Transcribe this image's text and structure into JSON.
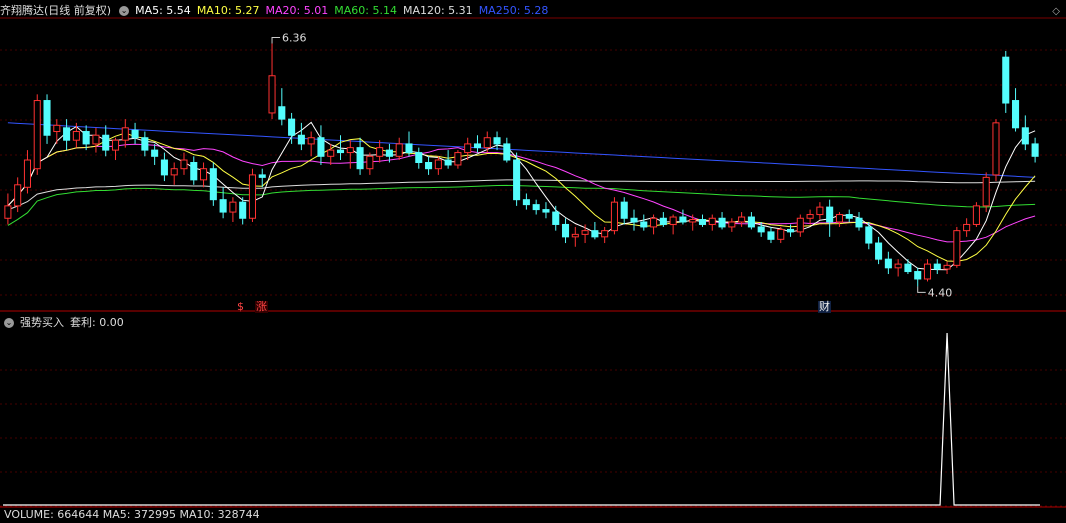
{
  "header": {
    "stock_name": "齐翔腾达(日线 前复权)",
    "ma": [
      {
        "label": "MA5: 5.54",
        "color": "#ffffff"
      },
      {
        "label": "MA10: 5.27",
        "color": "#ffff44"
      },
      {
        "label": "MA20: 5.01",
        "color": "#ff44ff"
      },
      {
        "label": "MA60: 5.14",
        "color": "#33dd33"
      },
      {
        "label": "MA120: 5.31",
        "color": "#dddddd"
      },
      {
        "label": "MA250: 5.28",
        "color": "#3355ff"
      }
    ]
  },
  "sub_header": {
    "indicator": "强势买入",
    "arbitrage": "套利: 0.00"
  },
  "volume_header": "VOLUME: 664644  MA5: 372995  MA10: 328744",
  "markers": {
    "zhang": "涨",
    "s": "$",
    "cai": "财"
  },
  "colors": {
    "up": "#ff3232",
    "down": "#54fcfc",
    "grid": "#8b0000",
    "ma5": "#ffffff",
    "ma10": "#ffff44",
    "ma20": "#ff44ff",
    "ma60": "#33dd33",
    "ma120": "#dddddd",
    "ma250": "#3355ff"
  },
  "icons": {
    "collapse": "chevron-down-icon",
    "corner": "diamond-icon"
  },
  "chart_data": {
    "type": "candlestick",
    "price_ylim": [
      4.25,
      6.55
    ],
    "annotations": [
      {
        "label": "6.36",
        "value": 6.36
      },
      {
        "label": "4.40",
        "value": 4.4
      }
    ],
    "candles": [
      [
        4.95,
        5.15,
        4.9,
        5.05
      ],
      [
        5.05,
        5.28,
        5.0,
        5.22
      ],
      [
        5.2,
        5.5,
        5.15,
        5.42
      ],
      [
        5.35,
        5.95,
        5.3,
        5.9
      ],
      [
        5.9,
        5.95,
        5.55,
        5.62
      ],
      [
        5.65,
        5.75,
        5.55,
        5.7
      ],
      [
        5.68,
        5.75,
        5.5,
        5.58
      ],
      [
        5.58,
        5.72,
        5.52,
        5.65
      ],
      [
        5.65,
        5.7,
        5.5,
        5.55
      ],
      [
        5.55,
        5.68,
        5.48,
        5.62
      ],
      [
        5.62,
        5.7,
        5.45,
        5.5
      ],
      [
        5.5,
        5.6,
        5.42,
        5.58
      ],
      [
        5.58,
        5.75,
        5.52,
        5.68
      ],
      [
        5.66,
        5.72,
        5.55,
        5.6
      ],
      [
        5.6,
        5.65,
        5.45,
        5.5
      ],
      [
        5.5,
        5.55,
        5.38,
        5.45
      ],
      [
        5.42,
        5.48,
        5.25,
        5.3
      ],
      [
        5.3,
        5.4,
        5.22,
        5.35
      ],
      [
        5.35,
        5.48,
        5.3,
        5.42
      ],
      [
        5.4,
        5.45,
        5.22,
        5.26
      ],
      [
        5.26,
        5.4,
        5.2,
        5.35
      ],
      [
        5.35,
        5.4,
        5.05,
        5.1
      ],
      [
        5.1,
        5.2,
        4.95,
        5.0
      ],
      [
        5.0,
        5.12,
        4.92,
        5.08
      ],
      [
        5.08,
        5.12,
        4.9,
        4.95
      ],
      [
        4.95,
        5.35,
        4.92,
        5.3
      ],
      [
        5.3,
        5.35,
        5.2,
        5.28
      ],
      [
        5.8,
        6.36,
        5.75,
        6.1
      ],
      [
        5.85,
        6.0,
        5.7,
        5.75
      ],
      [
        5.75,
        5.8,
        5.55,
        5.62
      ],
      [
        5.62,
        5.72,
        5.5,
        5.55
      ],
      [
        5.55,
        5.65,
        5.45,
        5.6
      ],
      [
        5.6,
        5.7,
        5.38,
        5.45
      ],
      [
        5.45,
        5.55,
        5.38,
        5.5
      ],
      [
        5.5,
        5.62,
        5.42,
        5.48
      ],
      [
        5.48,
        5.58,
        5.35,
        5.52
      ],
      [
        5.52,
        5.6,
        5.3,
        5.35
      ],
      [
        5.35,
        5.48,
        5.3,
        5.45
      ],
      [
        5.45,
        5.58,
        5.4,
        5.52
      ],
      [
        5.5,
        5.55,
        5.4,
        5.45
      ],
      [
        5.45,
        5.6,
        5.42,
        5.55
      ],
      [
        5.55,
        5.65,
        5.45,
        5.48
      ],
      [
        5.48,
        5.52,
        5.35,
        5.4
      ],
      [
        5.4,
        5.45,
        5.3,
        5.35
      ],
      [
        5.35,
        5.45,
        5.3,
        5.42
      ],
      [
        5.42,
        5.5,
        5.35,
        5.38
      ],
      [
        5.38,
        5.5,
        5.35,
        5.48
      ],
      [
        5.48,
        5.6,
        5.42,
        5.55
      ],
      [
        5.55,
        5.62,
        5.48,
        5.52
      ],
      [
        5.52,
        5.65,
        5.48,
        5.6
      ],
      [
        5.6,
        5.65,
        5.5,
        5.55
      ],
      [
        5.55,
        5.6,
        5.4,
        5.42
      ],
      [
        5.42,
        5.48,
        5.05,
        5.1
      ],
      [
        5.1,
        5.15,
        5.02,
        5.06
      ],
      [
        5.06,
        5.1,
        4.98,
        5.02
      ],
      [
        5.02,
        5.08,
        4.95,
        5.0
      ],
      [
        5.0,
        5.05,
        4.85,
        4.9
      ],
      [
        4.9,
        4.95,
        4.75,
        4.8
      ],
      [
        4.8,
        4.88,
        4.72,
        4.82
      ],
      [
        4.82,
        4.9,
        4.75,
        4.85
      ],
      [
        4.85,
        4.92,
        4.78,
        4.8
      ],
      [
        4.8,
        4.88,
        4.75,
        4.85
      ],
      [
        4.85,
        5.12,
        4.82,
        5.08
      ],
      [
        5.08,
        5.12,
        4.9,
        4.95
      ],
      [
        4.95,
        5.02,
        4.85,
        4.92
      ],
      [
        4.92,
        4.98,
        4.85,
        4.88
      ],
      [
        4.88,
        4.98,
        4.82,
        4.95
      ],
      [
        4.95,
        5.0,
        4.88,
        4.9
      ],
      [
        4.9,
        4.98,
        4.82,
        4.96
      ],
      [
        4.96,
        5.02,
        4.9,
        4.92
      ],
      [
        4.92,
        4.98,
        4.85,
        4.94
      ],
      [
        4.94,
        4.98,
        4.88,
        4.9
      ],
      [
        4.9,
        4.98,
        4.85,
        4.95
      ],
      [
        4.95,
        5.0,
        4.86,
        4.88
      ],
      [
        4.88,
        4.95,
        4.84,
        4.92
      ],
      [
        4.92,
        5.0,
        4.88,
        4.96
      ],
      [
        4.96,
        5.0,
        4.86,
        4.88
      ],
      [
        4.88,
        4.92,
        4.8,
        4.84
      ],
      [
        4.84,
        4.88,
        4.75,
        4.78
      ],
      [
        4.78,
        4.88,
        4.75,
        4.86
      ],
      [
        4.86,
        4.9,
        4.8,
        4.84
      ],
      [
        4.84,
        4.98,
        4.8,
        4.95
      ],
      [
        4.95,
        5.02,
        4.9,
        4.98
      ],
      [
        4.98,
        5.08,
        4.94,
        5.04
      ],
      [
        5.04,
        5.1,
        4.8,
        4.92
      ],
      [
        4.92,
        5.0,
        4.88,
        4.98
      ],
      [
        4.98,
        5.02,
        4.92,
        4.95
      ],
      [
        4.95,
        5.0,
        4.85,
        4.88
      ],
      [
        4.88,
        4.92,
        4.7,
        4.75
      ],
      [
        4.75,
        4.8,
        4.58,
        4.62
      ],
      [
        4.62,
        4.68,
        4.5,
        4.55
      ],
      [
        4.55,
        4.62,
        4.48,
        4.58
      ],
      [
        4.58,
        4.62,
        4.5,
        4.52
      ],
      [
        4.52,
        4.55,
        4.4,
        4.46
      ],
      [
        4.46,
        4.62,
        4.44,
        4.58
      ],
      [
        4.58,
        4.62,
        4.5,
        4.54
      ],
      [
        4.54,
        4.6,
        4.5,
        4.57
      ],
      [
        4.57,
        4.88,
        4.55,
        4.85
      ],
      [
        4.85,
        4.95,
        4.8,
        4.9
      ],
      [
        4.9,
        5.08,
        4.88,
        5.05
      ],
      [
        5.05,
        5.32,
        5.0,
        5.28
      ],
      [
        5.3,
        5.75,
        5.25,
        5.72
      ],
      [
        6.25,
        6.3,
        5.8,
        5.88
      ],
      [
        5.9,
        6.0,
        5.65,
        5.68
      ],
      [
        5.68,
        5.78,
        5.5,
        5.55
      ],
      [
        5.55,
        5.6,
        5.4,
        5.45
      ]
    ],
    "ma_names": [
      "MA5",
      "MA10",
      "MA20",
      "MA60",
      "MA120",
      "MA250"
    ],
    "indicator_ylim": [
      0,
      1.0
    ],
    "indicator_values": "zero except a single spike of 1.0 near the last bars"
  }
}
